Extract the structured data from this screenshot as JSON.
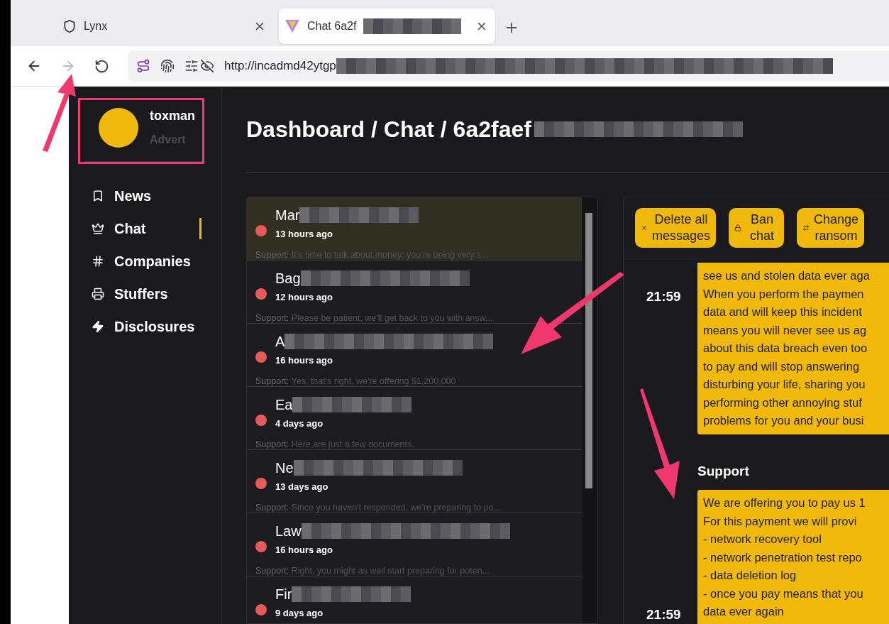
{
  "browser": {
    "tabs": [
      {
        "title": "Lynx",
        "selected": false,
        "kind": "shield"
      },
      {
        "title": "Chat 6a2f",
        "selected": true,
        "kind": "triangle"
      }
    ],
    "url": "http://incadmd42ytgp"
  },
  "profile": {
    "name": "toxman",
    "role": "Advert"
  },
  "nav": [
    {
      "label": "News",
      "kind": "bookmark",
      "selected": false
    },
    {
      "label": "Chat",
      "kind": "crown",
      "selected": true
    },
    {
      "label": "Companies",
      "kind": "hash",
      "selected": false
    },
    {
      "label": "Stuffers",
      "kind": "printer",
      "selected": false
    },
    {
      "label": "Disclosures",
      "kind": "bolt",
      "selected": false
    }
  ],
  "breadcrumb": "Dashboard / Chat / 6a2faef",
  "chats": [
    {
      "name": "Mar",
      "time": "13 hours ago",
      "sender": "Support:",
      "preview": "It’s time to talk about money; you’re being very s...",
      "selected": true
    },
    {
      "name": "Bag",
      "time": "12 hours ago",
      "sender": "Support:",
      "preview": "Please be patient; we'll get back to you with answ...",
      "selected": false
    },
    {
      "name": "A",
      "time": "16 hours ago",
      "sender": "Support:",
      "preview": "Yes, that's right, we're offering $1,200,000",
      "selected": false
    },
    {
      "name": "Ea",
      "time": "4 days ago",
      "sender": "Support:",
      "preview": "Here are just a few documents.",
      "selected": false
    },
    {
      "name": "Ne",
      "time": "13 days ago",
      "sender": "Support:",
      "preview": "Since you haven't responded, we're preparing to po...",
      "selected": false
    },
    {
      "name": "Law",
      "time": "16 hours ago",
      "sender": "Support:",
      "preview": "Right, you might as well start preparing for poten...",
      "selected": false
    },
    {
      "name": "Fir",
      "time": "9 days ago",
      "selected": false
    }
  ],
  "actions": [
    {
      "label": "Delete all messages",
      "kind": "x"
    },
    {
      "label": "Ban chat",
      "kind": "lock"
    },
    {
      "label": "Change ransom",
      "kind": "swap"
    }
  ],
  "messages": [
    {
      "time": "21:59",
      "lines": [
        "see us and stolen data ever aga",
        "When you perform the paymen",
        "data and will keep this incident",
        "means you will never see us ag",
        "about this data breach even too",
        "to pay and will stop answering",
        "disturbing your life, sharing you",
        "performing other annoying stuf",
        "problems for you and your busi"
      ]
    },
    {
      "sender": "Support",
      "time": "21:59",
      "lines": [
        "We are offering you to pay us 1",
        "For this payment we will provi",
        "- network recovery tool",
        "- network penetration test repo",
        "- data deletion log",
        "- once you pay means that you",
        "data ever again"
      ]
    }
  ]
}
